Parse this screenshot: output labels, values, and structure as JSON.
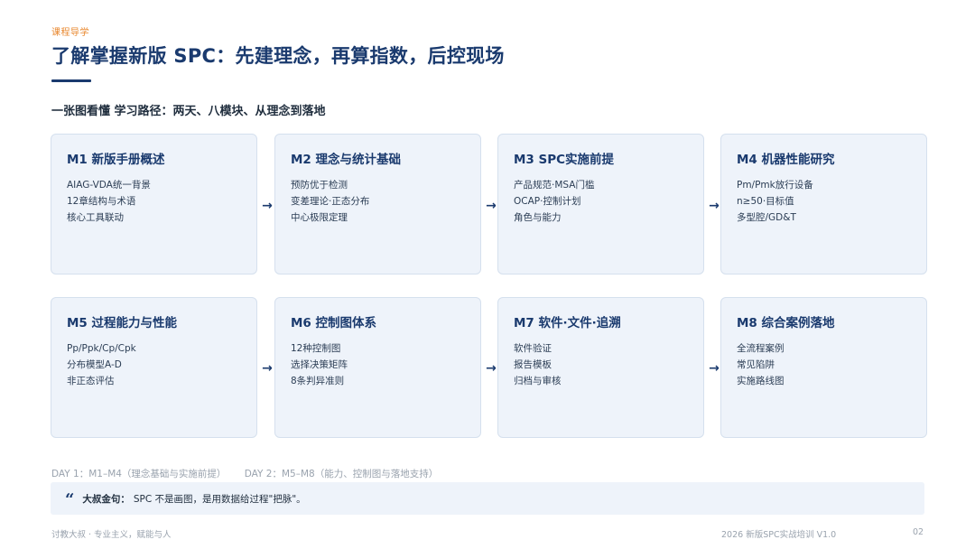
{
  "header": {
    "eyebrow": "课程导学",
    "title": "了解掌握新版 SPC：先建理念，再算指数，后控现场",
    "subtitle": "一张图看懂 学习路径：两天、八模块、从理念到落地"
  },
  "modules": [
    {
      "title": "M1 新版手册概述",
      "lines": [
        "AIAG-VDA统一背景",
        "12章结构与术语",
        "核心工具联动"
      ]
    },
    {
      "title": "M2 理念与统计基础",
      "lines": [
        "预防优于检测",
        "变差理论·正态分布",
        "中心极限定理"
      ]
    },
    {
      "title": "M3 SPC实施前提",
      "lines": [
        "产品规范·MSA门槛",
        "OCAP·控制计划",
        "角色与能力"
      ]
    },
    {
      "title": "M4 机器性能研究",
      "lines": [
        "Pm/Pmk放行设备",
        "n≥50·目标值",
        "多型腔/GD&T"
      ]
    },
    {
      "title": "M5 过程能力与性能",
      "lines": [
        "Pp/Ppk/Cp/Cpk",
        "分布模型A-D",
        "非正态评估"
      ]
    },
    {
      "title": "M6 控制图体系",
      "lines": [
        "12种控制图",
        "选择决策矩阵",
        "8条判异准则"
      ]
    },
    {
      "title": "M7 软件·文件·追溯",
      "lines": [
        "软件验证",
        "报告模板",
        "归档与审核"
      ]
    },
    {
      "title": "M8 综合案例落地",
      "lines": [
        "全流程案例",
        "常见陷阱",
        "实施路线图"
      ]
    }
  ],
  "arrow": "→",
  "days": {
    "day1": "DAY 1：M1–M4（理念基础与实施前提）",
    "day2": "DAY 2：M5–M8（能力、控制图与落地支持）"
  },
  "quote": {
    "icon": "“",
    "label": "大叔金句：",
    "text": "SPC 不是画图，是用数据给过程\"把脉\"。"
  },
  "footer": {
    "left": "讨教大叔 · 专业主义，赋能与人",
    "right": "2026 新版SPC实战培训 V1.0",
    "page": "02"
  },
  "colors": {
    "accent": "#e8862b",
    "primary": "#1a3a6e",
    "card_bg": "#eef3fa"
  }
}
